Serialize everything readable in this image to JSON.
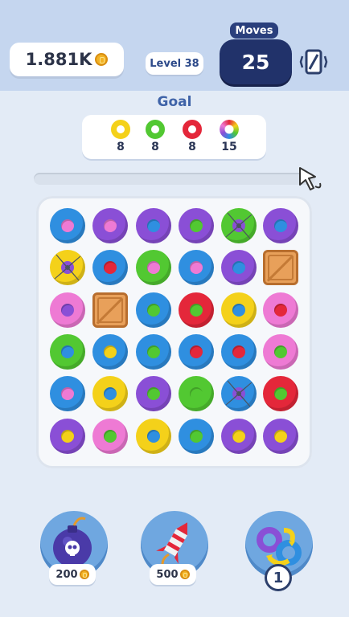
{
  "header": {
    "coins_value": "1.881K",
    "level_label": "Level 38",
    "moves_label": "Moves",
    "moves_value": "25"
  },
  "goal": {
    "title": "Goal",
    "items": [
      {
        "color": "yellow",
        "count": "8"
      },
      {
        "color": "green",
        "count": "8"
      },
      {
        "color": "red",
        "count": "8"
      },
      {
        "color": "rainbow",
        "count": "15"
      }
    ]
  },
  "colors": {
    "blue": "#2f8fe0",
    "purple": "#8a4fd6",
    "pink": "#ee7ad4",
    "green": "#52c832",
    "red": "#e4273a",
    "yellow": "#f4d11a",
    "crate": "#e8a05a"
  },
  "board": {
    "rows": [
      [
        [
          "blue",
          "pink"
        ],
        [
          "purple",
          "pink"
        ],
        [
          "purple",
          "blue"
        ],
        [
          "purple",
          "green"
        ],
        [
          "green",
          "shuriken"
        ],
        [
          "purple",
          "blue"
        ]
      ],
      [
        [
          "yellow",
          "shuriken"
        ],
        [
          "blue",
          "red"
        ],
        [
          "green",
          "pink"
        ],
        [
          "blue",
          "pink"
        ],
        [
          "purple",
          "blue"
        ],
        [
          "crate",
          ""
        ]
      ],
      [
        [
          "pink",
          "purple"
        ],
        [
          "crate",
          ""
        ],
        [
          "blue",
          "green"
        ],
        [
          "red",
          "green"
        ],
        [
          "yellow",
          "blue"
        ],
        [
          "pink",
          "red"
        ]
      ],
      [
        [
          "green",
          "blue"
        ],
        [
          "blue",
          "yellow"
        ],
        [
          "blue",
          "green"
        ],
        [
          "blue",
          "red"
        ],
        [
          "blue",
          "red"
        ],
        [
          "pink",
          "green"
        ]
      ],
      [
        [
          "blue",
          "pink"
        ],
        [
          "yellow",
          "blue"
        ],
        [
          "purple",
          "green"
        ],
        [
          "green",
          "green"
        ],
        [
          "blue",
          "shuriken"
        ],
        [
          "red",
          "green"
        ]
      ],
      [
        [
          "purple",
          "yellow"
        ],
        [
          "pink",
          "green"
        ],
        [
          "yellow",
          "blue"
        ],
        [
          "blue",
          "green"
        ],
        [
          "purple",
          "yellow"
        ],
        [
          "purple",
          "yellow"
        ]
      ]
    ]
  },
  "boosters": [
    {
      "name": "bomb",
      "price": "200"
    },
    {
      "name": "rocket",
      "price": "500"
    },
    {
      "name": "shuffle",
      "count": "1"
    }
  ]
}
